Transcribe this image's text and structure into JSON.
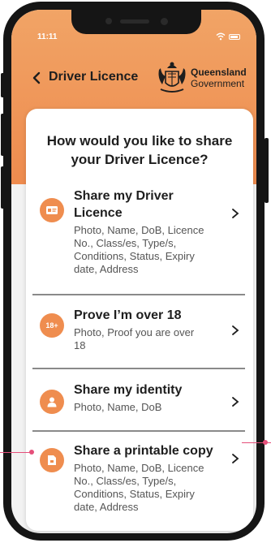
{
  "status_bar": {
    "time": "11:11"
  },
  "header": {
    "back_icon": "chevron-left-icon",
    "title": "Driver Licence",
    "logo_line1": "Queensland",
    "logo_line2": "Government"
  },
  "card": {
    "title": "How would you like to share your Driver Licence?",
    "options": [
      {
        "icon": "id-card-icon",
        "title": "Share my Driver Licence",
        "description": "Photo, Name, DoB, Licence No., Class/es, Type/s, Conditions, Status, Expiry date, Address"
      },
      {
        "icon_text": "18+",
        "title": "Prove I’m over 18",
        "description": "Photo, Proof you are over 18"
      },
      {
        "icon": "person-icon",
        "title": "Share my identity",
        "description": "Photo, Name, DoB"
      },
      {
        "icon": "document-icon",
        "title": "Share a printable copy",
        "description": "Photo, Name, DoB, Licence No., Class/es, Type/s, Conditions, Status, Expiry date, Address"
      }
    ]
  },
  "colors": {
    "accent": "#ef8d4f",
    "header_top": "#f1a466",
    "pointer": "#e54f7a"
  }
}
